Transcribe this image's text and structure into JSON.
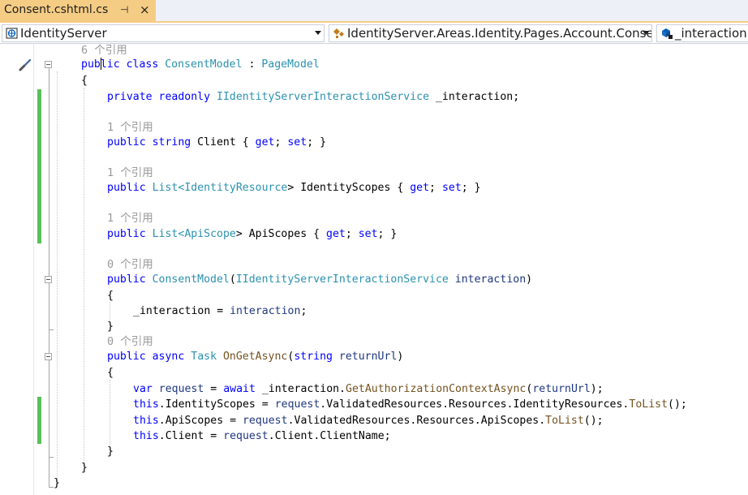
{
  "tab": {
    "title": "Consent.cshtml.cs",
    "pin_glyph": "⊣",
    "close_glyph": "×",
    "active_color": "#f5cc84"
  },
  "navbar": {
    "project": "IdentityServer",
    "type": "IdentityServer.Areas.Identity.Pages.Account.Consent",
    "member": "_interaction",
    "project_icon": "csharp-project-icon",
    "type_icon": "class-icon",
    "member_icon": "field-icon"
  },
  "editor": {
    "change_bar_color": "#58c058",
    "refs": {
      "class": "6 个引用",
      "client": "1 个引用",
      "identity_scopes": "1 个引用",
      "api_scopes": "1 个引用",
      "ctor": "0 个引用",
      "get": "0 个引用"
    },
    "code": {
      "class_decl": [
        "pub",
        "lic",
        " class ",
        "ConsentModel",
        " : ",
        "PageModel"
      ],
      "open_brace": "{",
      "close_brace": "}",
      "field": [
        "private",
        " ",
        "readonly",
        " ",
        "IIdentityServerInteractionService",
        " _interaction;"
      ],
      "client_prop": [
        "public",
        " ",
        "string",
        " Client { ",
        "get",
        "; ",
        "set",
        "; }"
      ],
      "identity_prop": [
        "public",
        " ",
        "List",
        "<",
        "IdentityResource",
        "> IdentityScopes { ",
        "get",
        "; ",
        "set",
        "; }"
      ],
      "api_prop": [
        "public",
        " ",
        "List",
        "<",
        "ApiScope",
        "> ApiScopes { ",
        "get",
        "; ",
        "set",
        "; }"
      ],
      "ctor_decl": [
        "public",
        " ",
        "ConsentModel",
        "(",
        "IIdentityServerInteractionService",
        " ",
        "interaction",
        ")"
      ],
      "ctor_body": [
        "_interaction = ",
        "interaction",
        ";"
      ],
      "get_decl": [
        "public",
        " ",
        "async",
        " ",
        "Task",
        " ",
        "OnGetAsync",
        "(",
        "string",
        " ",
        "returnUrl",
        ")"
      ],
      "stmt1": [
        "var",
        " ",
        "request",
        " = ",
        "await",
        " _interaction.",
        "GetAuthorizationContextAsync",
        "(",
        "returnUrl",
        ");"
      ],
      "stmt2": [
        "this",
        ".IdentityScopes = ",
        "request",
        ".ValidatedResources.Resources.IdentityResources.",
        "ToList",
        "();"
      ],
      "stmt3": [
        "this",
        ".ApiScopes = ",
        "request",
        ".ValidatedResources.Resources.ApiScopes.",
        "ToList",
        "();"
      ],
      "stmt4": [
        "this",
        ".Client = ",
        "request",
        ".Client.ClientName;"
      ]
    }
  }
}
